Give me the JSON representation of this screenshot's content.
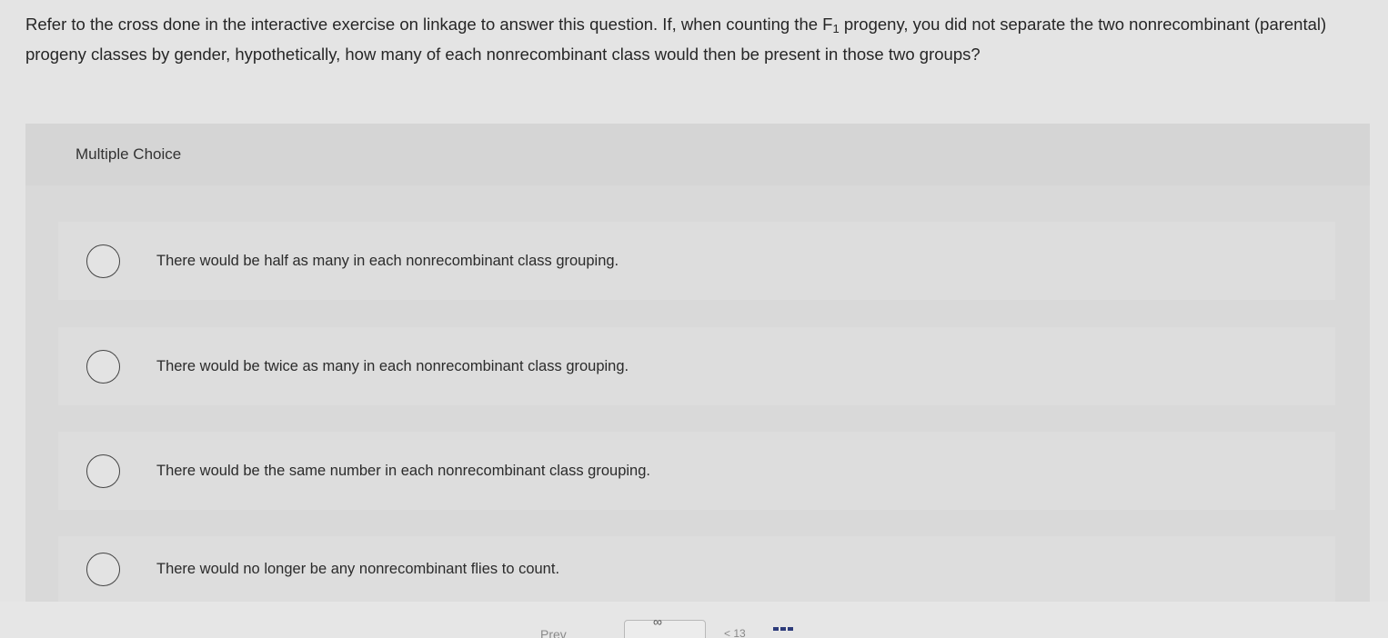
{
  "question": {
    "text_before_sub": "Refer to the cross done in the interactive exercise on linkage to answer this question. If, when counting the F",
    "subscript": "1",
    "text_after_sub": " progeny, you did not separate the two nonrecombinant (parental) progeny classes by gender, hypothetically, how many of each nonrecombinant class would then be present in those two groups?"
  },
  "panel": {
    "header": "Multiple Choice"
  },
  "choices": [
    {
      "label": "There would be half as many in each nonrecombinant class grouping."
    },
    {
      "label": "There would be twice as many in each nonrecombinant class grouping."
    },
    {
      "label": "There would be the same number in each nonrecombinant class grouping."
    },
    {
      "label": "There would no longer be any nonrecombinant flies to count."
    }
  ],
  "bottom_bar": {
    "prev_label": "Prev",
    "page_fragment": "< 13",
    "icons": [
      "link-icon",
      "grid-icon"
    ]
  }
}
